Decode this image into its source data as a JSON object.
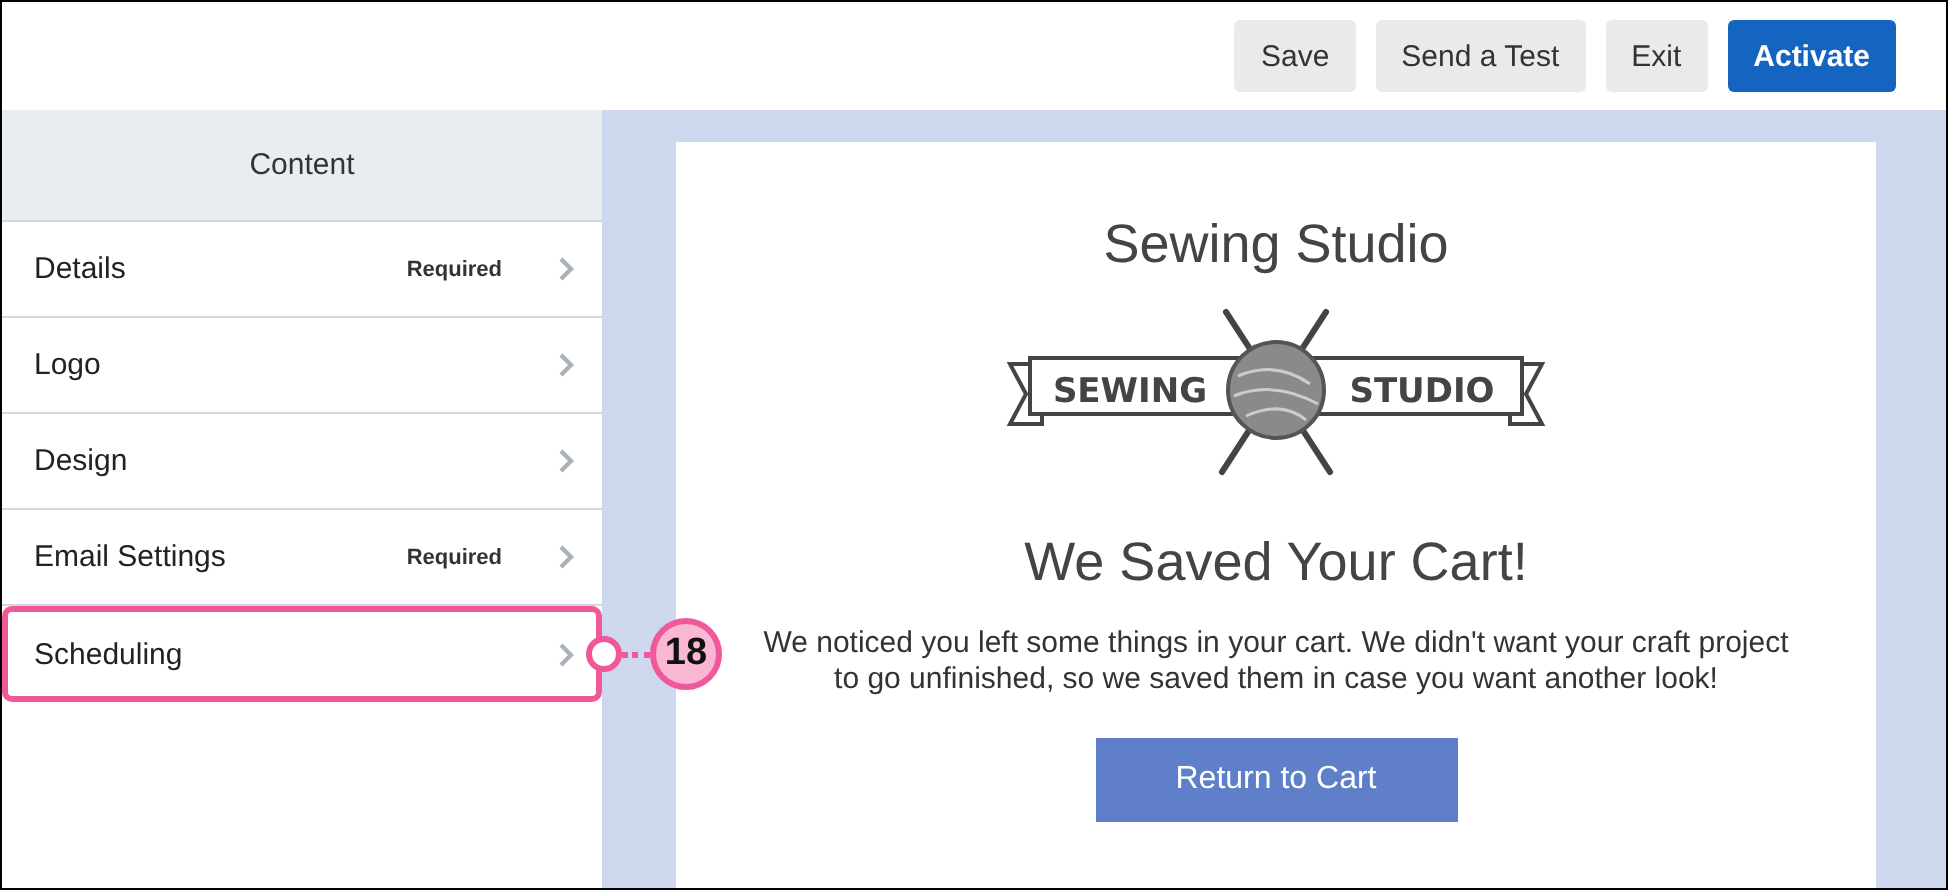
{
  "toolbar": {
    "buttons": [
      {
        "label": "Save",
        "kind": "plain"
      },
      {
        "label": "Send a Test",
        "kind": "plain"
      },
      {
        "label": "Exit",
        "kind": "plain"
      },
      {
        "label": "Activate",
        "kind": "primary"
      }
    ]
  },
  "sidebar": {
    "header": "Content",
    "items": [
      {
        "label": "Details",
        "tag": "Required",
        "highlighted": false
      },
      {
        "label": "Logo",
        "highlighted": false
      },
      {
        "label": "Design",
        "highlighted": false
      },
      {
        "label": "Email Settings",
        "tag": "Required",
        "highlighted": false
      },
      {
        "label": "Scheduling",
        "highlighted": true
      }
    ]
  },
  "callout": {
    "number": "18"
  },
  "email": {
    "title": "Sewing Studio",
    "logo": {
      "left_word": "SEWING",
      "right_word": "STUDIO"
    },
    "heading": "We Saved Your Cart!",
    "message": "We noticed you left some things in your cart. We didn't want your craft project to go unfinished, so we saved them in case you want another look!",
    "button": "Return to Cart"
  }
}
